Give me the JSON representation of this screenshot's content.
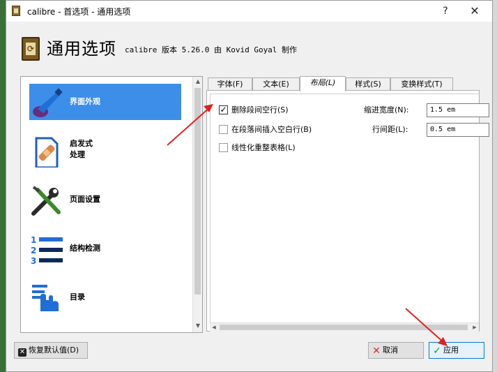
{
  "window": {
    "title": "calibre - 首选项 - 通用选项",
    "help_glyph": "?",
    "close_glyph": "✕"
  },
  "header": {
    "title": "通用选项",
    "subtitle": "calibre 版本 5.26.0 由 Kovid Goyal 制作",
    "icon_glyph": "⟳"
  },
  "sidebar": {
    "items": [
      {
        "label": "界面外观",
        "icon": "paintbrush-icon",
        "selected": true
      },
      {
        "label": "启发式\n处理",
        "icon": "document-bandage-icon",
        "selected": false
      },
      {
        "label": "页面设置",
        "icon": "wrench-screwdriver-icon",
        "selected": false
      },
      {
        "label": "结构检测",
        "icon": "numbered-list-icon",
        "selected": false
      },
      {
        "label": "目录",
        "icon": "hand-pointer-icon",
        "selected": false
      }
    ]
  },
  "tabs": [
    {
      "label": "字体(F)",
      "active": false
    },
    {
      "label": "文本(E)",
      "active": false
    },
    {
      "label": "布局(L)",
      "active": true
    },
    {
      "label": "样式(S)",
      "active": false
    },
    {
      "label": "变换样式(T)",
      "active": false
    }
  ],
  "layout_tab": {
    "options": [
      {
        "label": "删除段间空行(S)",
        "checked": true
      },
      {
        "label": "在段落间插入空白行(B)",
        "checked": false
      },
      {
        "label": "线性化重整表格(L)",
        "checked": false
      }
    ],
    "indent_label": "缩进宽度(N):",
    "indent_value": "1.5 em",
    "spacing_label": "行间距(L):",
    "spacing_value": "0.5 em"
  },
  "buttons": {
    "restore": "恢复默认值(D)",
    "cancel": "取消",
    "apply": "应用"
  },
  "colors": {
    "selection": "#3d8ee8",
    "annotation_arrow": "#e02020",
    "check_green": "#1a9a2a",
    "cancel_red": "#c0392b"
  }
}
